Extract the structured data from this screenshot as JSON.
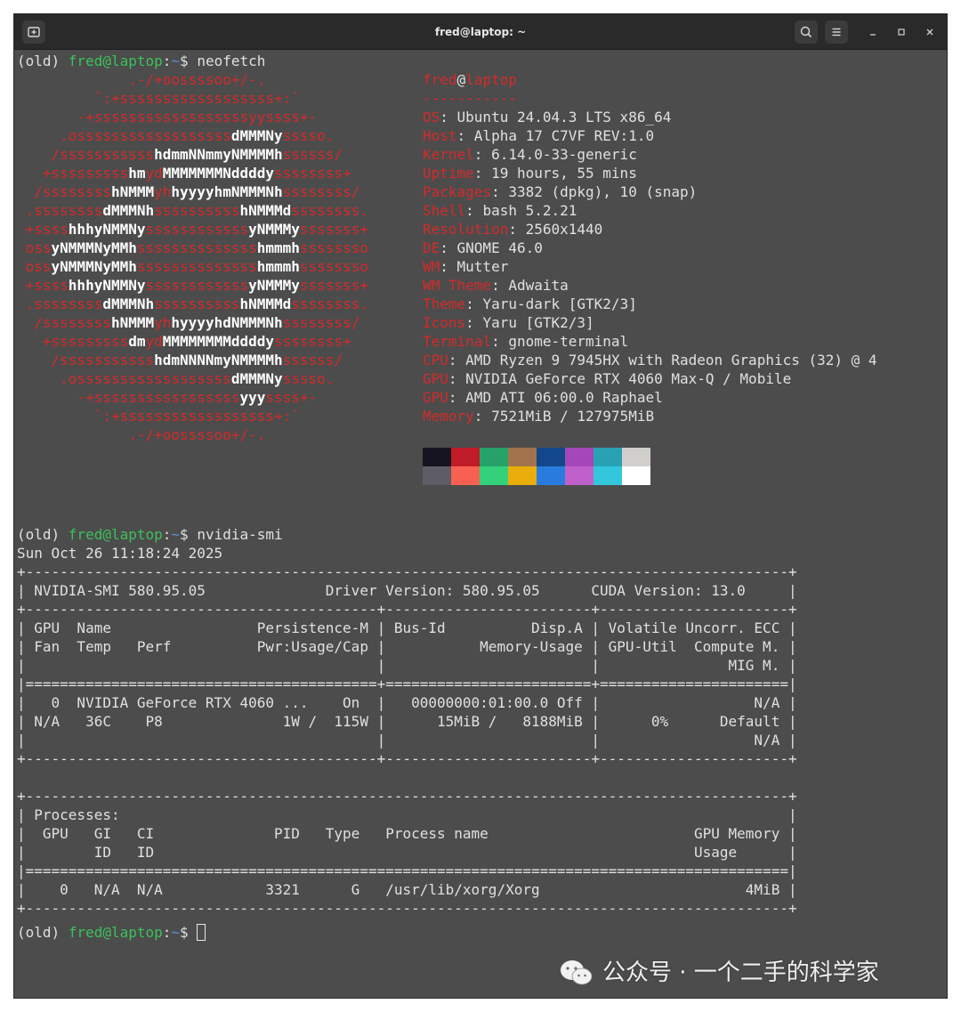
{
  "window": {
    "title": "fred@laptop: ~"
  },
  "prompt": {
    "env": "(old) ",
    "user": "fred@laptop",
    "sep": ":",
    "path": "~",
    "dollar": "$ "
  },
  "commands": {
    "neofetch": "neofetch",
    "nvidia_smi": "nvidia-smi"
  },
  "logo_lines": [
    [
      [
        "r",
        "             .-/+oossssoo+/-."
      ]
    ],
    [
      [
        "r",
        "         `:+ssssssssssssssssss+:`"
      ]
    ],
    [
      [
        "r",
        "       -+ssssssssssssssssssyyssss+-"
      ]
    ],
    [
      [
        "r",
        "     .ossssssssssssssssss"
      ],
      [
        "w",
        "dMMMNy"
      ],
      [
        "r",
        "sssso."
      ]
    ],
    [
      [
        "r",
        "    /sssssssssss"
      ],
      [
        "w",
        "hdmmNNmmyNMMMMh"
      ],
      [
        "r",
        "ssssss/"
      ]
    ],
    [
      [
        "r",
        "   +sssssssss"
      ],
      [
        "w",
        "hm"
      ],
      [
        "r",
        "yd"
      ],
      [
        "w",
        "MMMMMMMNddddy"
      ],
      [
        "r",
        "ssssssss+"
      ]
    ],
    [
      [
        "r",
        "  /ssssssss"
      ],
      [
        "w",
        "hNMMM"
      ],
      [
        "r",
        "yh"
      ],
      [
        "w",
        "hyyyyhmNMMMNh"
      ],
      [
        "r",
        "ssssssss/"
      ]
    ],
    [
      [
        "r",
        " .ssssssss"
      ],
      [
        "w",
        "dMMMNh"
      ],
      [
        "r",
        "ssssssssss"
      ],
      [
        "w",
        "hNMMMd"
      ],
      [
        "r",
        "ssssssss."
      ]
    ],
    [
      [
        "r",
        " +ssss"
      ],
      [
        "w",
        "hhhyNMMNy"
      ],
      [
        "r",
        "ssssssssssss"
      ],
      [
        "w",
        "yNMMMy"
      ],
      [
        "r",
        "sssssss+"
      ]
    ],
    [
      [
        "r",
        " oss"
      ],
      [
        "w",
        "yNMMMNyMMh"
      ],
      [
        "r",
        "ssssssssssssss"
      ],
      [
        "w",
        "hmmmh"
      ],
      [
        "r",
        "ssssssso"
      ]
    ],
    [
      [
        "r",
        " oss"
      ],
      [
        "w",
        "yNMMMNyMMh"
      ],
      [
        "r",
        "ssssssssssssss"
      ],
      [
        "w",
        "hmmmh"
      ],
      [
        "r",
        "ssssssso"
      ]
    ],
    [
      [
        "r",
        " +ssss"
      ],
      [
        "w",
        "hhhyNMMNy"
      ],
      [
        "r",
        "ssssssssssss"
      ],
      [
        "w",
        "yNMMMy"
      ],
      [
        "r",
        "sssssss+"
      ]
    ],
    [
      [
        "r",
        " .ssssssss"
      ],
      [
        "w",
        "dMMMNh"
      ],
      [
        "r",
        "ssssssssss"
      ],
      [
        "w",
        "hNMMMd"
      ],
      [
        "r",
        "ssssssss."
      ]
    ],
    [
      [
        "r",
        "  /ssssssss"
      ],
      [
        "w",
        "hNMMM"
      ],
      [
        "r",
        "yh"
      ],
      [
        "w",
        "hyyyyhdNMMMNh"
      ],
      [
        "r",
        "ssssssss/"
      ]
    ],
    [
      [
        "r",
        "   +sssssssss"
      ],
      [
        "w",
        "dm"
      ],
      [
        "r",
        "yd"
      ],
      [
        "w",
        "MMMMMMMMddddy"
      ],
      [
        "r",
        "ssssssss+"
      ]
    ],
    [
      [
        "r",
        "    /sssssssssss"
      ],
      [
        "w",
        "hdmNNNNmyNMMMMh"
      ],
      [
        "r",
        "ssssss/"
      ]
    ],
    [
      [
        "r",
        "     .ossssssssssssssssss"
      ],
      [
        "w",
        "dMMMNy"
      ],
      [
        "r",
        "sssso."
      ]
    ],
    [
      [
        "r",
        "       -+sssssssssssssssss"
      ],
      [
        "w",
        "yyy"
      ],
      [
        "r",
        "ssss+-"
      ]
    ],
    [
      [
        "r",
        "         `:+ssssssssssssssssss+:`"
      ]
    ],
    [
      [
        "r",
        "             .-/+oossssoo+/-."
      ]
    ]
  ],
  "sysinfo": {
    "user": "fred",
    "at": "@",
    "host": "laptop",
    "separator": "-----------",
    "items": [
      {
        "key": "OS",
        "value": ": Ubuntu 24.04.3 LTS x86_64"
      },
      {
        "key": "Host",
        "value": ": Alpha 17 C7VF REV:1.0"
      },
      {
        "key": "Kernel",
        "value": ": 6.14.0-33-generic"
      },
      {
        "key": "Uptime",
        "value": ": 19 hours, 55 mins"
      },
      {
        "key": "Packages",
        "value": ": 3382 (dpkg), 10 (snap)"
      },
      {
        "key": "Shell",
        "value": ": bash 5.2.21"
      },
      {
        "key": "Resolution",
        "value": ": 2560x1440"
      },
      {
        "key": "DE",
        "value": ": GNOME 46.0"
      },
      {
        "key": "WM",
        "value": ": Mutter"
      },
      {
        "key": "WM Theme",
        "value": ": Adwaita"
      },
      {
        "key": "Theme",
        "value": ": Yaru-dark [GTK2/3]"
      },
      {
        "key": "Icons",
        "value": ": Yaru [GTK2/3]"
      },
      {
        "key": "Terminal",
        "value": ": gnome-terminal"
      },
      {
        "key": "CPU",
        "value": ": AMD Ryzen 9 7945HX with Radeon Graphics (32) @ 4"
      },
      {
        "key": "GPU",
        "value": ": NVIDIA GeForce RTX 4060 Max-Q / Mobile"
      },
      {
        "key": "GPU",
        "value": ": AMD ATI 06:00.0 Raphael"
      },
      {
        "key": "Memory",
        "value": ": 7521MiB / 127975MiB"
      }
    ]
  },
  "palette": {
    "row1": [
      "#171421",
      "#c01c28",
      "#26a269",
      "#a2734c",
      "#12488b",
      "#a347ba",
      "#2aa1b3",
      "#d0cfcc"
    ],
    "row2": [
      "#5e5c64",
      "#f66151",
      "#33d17a",
      "#e9ad0c",
      "#2a7bde",
      "#c061cb",
      "#33c7de",
      "#ffffff"
    ]
  },
  "smi": {
    "date": "Sun Oct 26 11:18:24 2025",
    "lines": [
      "+-----------------------------------------------------------------------------------------+",
      "| NVIDIA-SMI 580.95.05              Driver Version: 580.95.05      CUDA Version: 13.0     |",
      "+-----------------------------------------+------------------------+----------------------+",
      "| GPU  Name                 Persistence-M | Bus-Id          Disp.A | Volatile Uncorr. ECC |",
      "| Fan  Temp   Perf          Pwr:Usage/Cap |           Memory-Usage | GPU-Util  Compute M. |",
      "|                                         |                        |               MIG M. |",
      "|=========================================+========================+======================|",
      "|   0  NVIDIA GeForce RTX 4060 ...    On  |   00000000:01:00.0 Off |                  N/A |",
      "| N/A   36C    P8              1W /  115W |      15MiB /   8188MiB |      0%      Default |",
      "|                                         |                        |                  N/A |",
      "+-----------------------------------------+------------------------+----------------------+",
      "",
      "+-----------------------------------------------------------------------------------------+",
      "| Processes:                                                                              |",
      "|  GPU   GI   CI              PID   Type   Process name                        GPU Memory |",
      "|        ID   ID                                                               Usage      |",
      "|=========================================================================================|",
      "|    0   N/A  N/A            3321      G   /usr/lib/xorg/Xorg                        4MiB |",
      "+-----------------------------------------------------------------------------------------+"
    ]
  },
  "watermark": {
    "text": "公众号 · 一个二手的科学家"
  }
}
